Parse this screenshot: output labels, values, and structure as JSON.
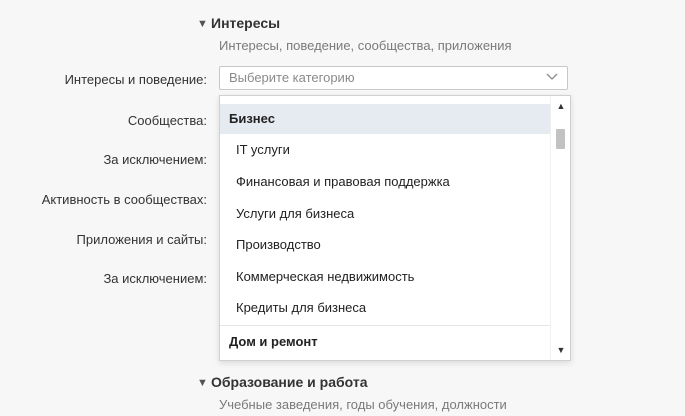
{
  "interests_section": {
    "title": "Интересы",
    "subtitle": "Интересы, поведение, сообщества, приложения"
  },
  "rows": [
    {
      "label": "Интересы и поведение:"
    },
    {
      "label": "Сообщества:"
    },
    {
      "label": "За исключением:"
    },
    {
      "label": "Активность в сообществах:"
    },
    {
      "label": "Приложения и сайты:"
    },
    {
      "label": "За исключением:"
    }
  ],
  "category_select": {
    "placeholder": "Выберите категорию",
    "icon": "chevron-down-icon"
  },
  "dropdown": {
    "groups": [
      {
        "label": "Бизнес",
        "items": [
          "IT услуги",
          "Финансовая и правовая поддержка",
          "Услуги для бизнеса",
          "Производство",
          "Коммерческая недвижимость",
          "Кредиты для бизнеса"
        ]
      },
      {
        "label": "Дом и ремонт",
        "items": []
      }
    ],
    "scroll_position": 0.1
  },
  "education_section": {
    "title": "Образование и работа",
    "subtitle": "Учебные заведения, годы обучения, должности"
  },
  "colors": {
    "background": "#f7f7f7",
    "highlight": "#e6ebf2",
    "label": "#333333",
    "muted": "#7a7a7a"
  }
}
